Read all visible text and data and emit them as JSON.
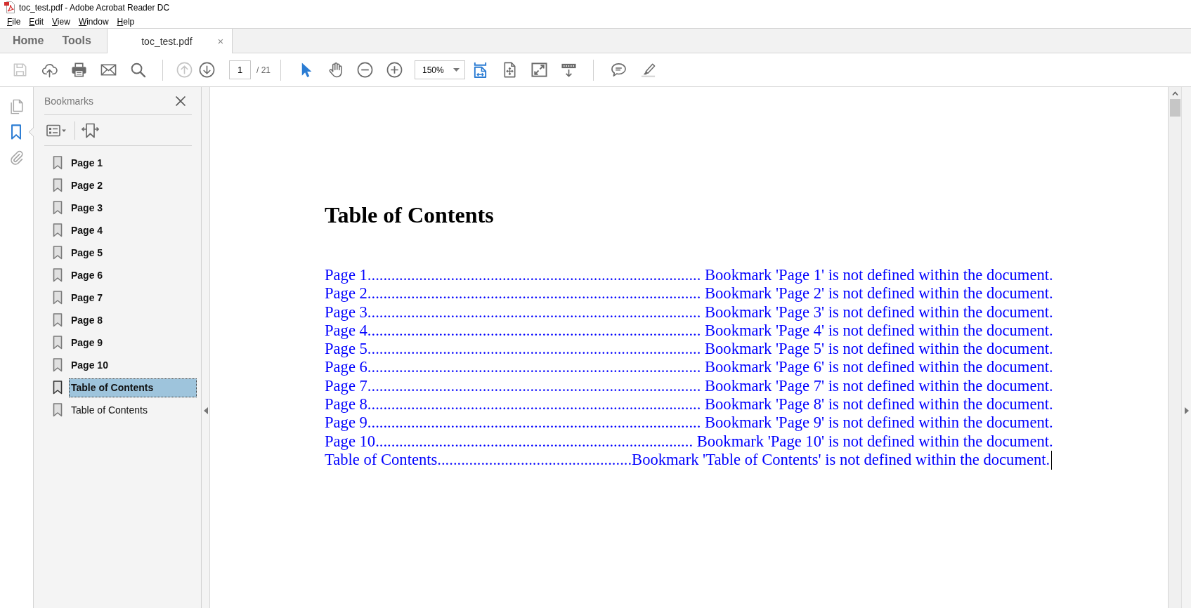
{
  "window": {
    "title": "toc_test.pdf - Adobe Acrobat Reader DC"
  },
  "menu_bar": [
    "File",
    "Edit",
    "View",
    "Window",
    "Help"
  ],
  "nav_tabs": [
    {
      "label": "Home",
      "selected": false
    },
    {
      "label": "Tools",
      "selected": false
    }
  ],
  "document_tabs": [
    {
      "label": "toc_test.pdf",
      "close": "×",
      "selected": true
    }
  ],
  "toolbar": [
    {
      "kind": "save",
      "disabled": true,
      "selected": false
    },
    {
      "kind": "upload",
      "disabled": false,
      "selected": false
    },
    {
      "kind": "print",
      "disabled": false,
      "selected": false
    },
    {
      "kind": "mail",
      "disabled": false,
      "selected": false
    },
    {
      "kind": "search",
      "disabled": false,
      "selected": false
    },
    {
      "kind": "separator"
    },
    {
      "kind": "previous-page",
      "disabled": true,
      "selected": false
    },
    {
      "kind": "next-page",
      "disabled": false,
      "selected": false
    },
    {
      "kind": "page-number",
      "value": "1",
      "total": "/ 21"
    },
    {
      "kind": "separator"
    },
    {
      "kind": "select",
      "disabled": false,
      "selected": true
    },
    {
      "kind": "hand",
      "disabled": false,
      "selected": false
    },
    {
      "kind": "zoom-out",
      "disabled": false,
      "selected": false
    },
    {
      "kind": "zoom-in",
      "disabled": false,
      "selected": false
    },
    {
      "kind": "zoom-level",
      "value": "150%"
    },
    {
      "kind": "fit-width",
      "disabled": false,
      "selected": true
    },
    {
      "kind": "scroll-mode",
      "disabled": false,
      "selected": false
    },
    {
      "kind": "full-screen",
      "disabled": false,
      "selected": false
    },
    {
      "kind": "read-mode",
      "disabled": false,
      "selected": false
    },
    {
      "kind": "separator"
    },
    {
      "kind": "comment",
      "disabled": false,
      "selected": false
    },
    {
      "kind": "highlight",
      "disabled": false,
      "selected": false
    }
  ],
  "side_rail": [
    {
      "kind": "pages",
      "selected": false
    },
    {
      "kind": "bookmarks",
      "selected": true
    },
    {
      "kind": "attachments",
      "selected": false
    }
  ],
  "bookmarks_panel": {
    "title": "Bookmarks",
    "items": [
      {
        "label": "Page 1",
        "bold": true,
        "selected": false
      },
      {
        "label": "Page 2",
        "bold": true,
        "selected": false
      },
      {
        "label": "Page 3",
        "bold": true,
        "selected": false
      },
      {
        "label": "Page 4",
        "bold": true,
        "selected": false
      },
      {
        "label": "Page 5",
        "bold": true,
        "selected": false
      },
      {
        "label": "Page 6",
        "bold": true,
        "selected": false
      },
      {
        "label": "Page 7",
        "bold": true,
        "selected": false
      },
      {
        "label": "Page 8",
        "bold": true,
        "selected": false
      },
      {
        "label": "Page 9",
        "bold": true,
        "selected": false
      },
      {
        "label": "Page 10",
        "bold": true,
        "selected": false
      },
      {
        "label": "Table of Contents",
        "bold": true,
        "selected": true
      },
      {
        "label": "Table of Contents",
        "bold": false,
        "selected": false
      }
    ]
  },
  "document": {
    "heading": "Table of Contents",
    "entries": [
      "Page 1.................................................................................... Bookmark 'Page 1' is not defined within the document.",
      "Page 2.................................................................................... Bookmark 'Page 2' is not defined within the document.",
      "Page 3.................................................................................... Bookmark 'Page 3' is not defined within the document.",
      "Page 4.................................................................................... Bookmark 'Page 4' is not defined within the document.",
      "Page 5.................................................................................... Bookmark 'Page 5' is not defined within the document.",
      "Page 6.................................................................................... Bookmark 'Page 6' is not defined within the document.",
      "Page 7.................................................................................... Bookmark 'Page 7' is not defined within the document.",
      "Page 8.................................................................................... Bookmark 'Page 8' is not defined within the document.",
      "Page 9.................................................................................... Bookmark 'Page 9' is not defined within the document.",
      "Page 10................................................................................ Bookmark 'Page 10' is not defined within the document.",
      "Table of Contents.................................................Bookmark 'Table of Contents' is not defined within the document."
    ],
    "text_caret": true
  }
}
